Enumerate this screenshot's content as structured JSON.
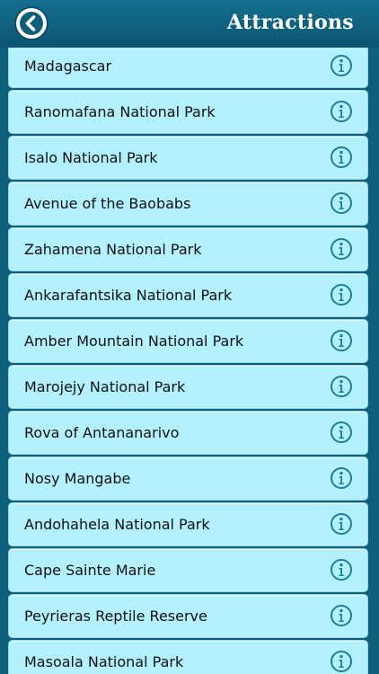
{
  "header": {
    "title": "Attractions",
    "back_icon": "back-arrow-icon"
  },
  "list": {
    "items": [
      {
        "label": "Madagascar"
      },
      {
        "label": "Ranomafana National Park"
      },
      {
        "label": "Isalo National Park"
      },
      {
        "label": "Avenue of the Baobabs"
      },
      {
        "label": "Zahamena National Park"
      },
      {
        "label": "Ankarafantsika National Park"
      },
      {
        "label": "Amber Mountain National Park"
      },
      {
        "label": "Marojejy National Park"
      },
      {
        "label": "Rova of Antananarivo"
      },
      {
        "label": "Nosy Mangabe"
      },
      {
        "label": "Andohahela National Park"
      },
      {
        "label": "Cape Sainte Marie"
      },
      {
        "label": "Peyrieras Reptile Reserve"
      },
      {
        "label": "Masoala National Park"
      }
    ],
    "info_icon": "info-icon"
  },
  "colors": {
    "header_bg": "#0d5f7c",
    "row_bg": "#b3f1ff",
    "icon": "#1c7d9d"
  }
}
